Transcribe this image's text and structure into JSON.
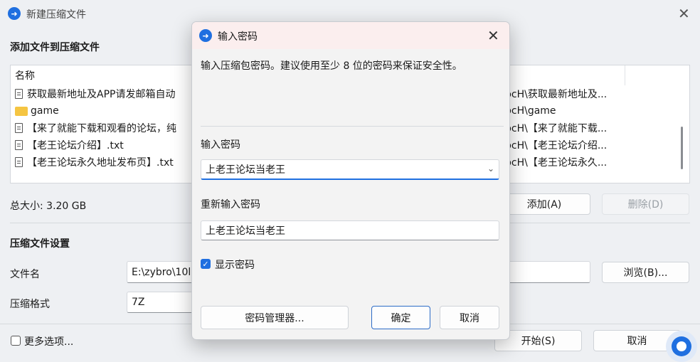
{
  "main": {
    "title": "新建压缩文件",
    "section_add": "添加文件到压缩文件",
    "column_name": "名称",
    "files": [
      {
        "name": "获取最新地址及APP请发邮箱自动",
        "path": "pcH\\获取最新地址及...",
        "icon": "file"
      },
      {
        "name": "game",
        "path": "pcH\\game",
        "icon": "folder"
      },
      {
        "name": "【来了就能下载和观看的论坛，纯",
        "path": "pcH\\【来了就能下载...",
        "icon": "file"
      },
      {
        "name": "【老王论坛介绍】.txt",
        "path": "pcH\\【老王论坛介绍...",
        "icon": "file"
      },
      {
        "name": "【老王论坛永久地址发布页】.txt",
        "path": "pcH\\【老王论坛永久...",
        "icon": "file"
      }
    ],
    "total_size": "总大小: 3.20 GB",
    "add_button": "添加(A)",
    "delete_button": "删除(D)",
    "section_settings": "压缩文件设置",
    "filename_label": "文件名",
    "filename_value": "E:\\zybro\\10l",
    "browse_button": "浏览(B)...",
    "format_label": "压缩格式",
    "format_value": "7Z",
    "more_options": "更多选项...",
    "start_button": "开始(S)",
    "cancel_button": "取消"
  },
  "dialog": {
    "title": "输入密码",
    "description": "输入压缩包密码。建议使用至少 8 位的密码来保证安全性。",
    "password_label": "输入密码",
    "password_value": "上老王论坛当老王",
    "reenter_label": "重新输入密码",
    "reenter_value": "上老王论坛当老王",
    "show_password_label": "显示密码",
    "show_password_checked": true,
    "manager_button": "密码管理器...",
    "ok_button": "确定",
    "cancel_button": "取消"
  },
  "colors": {
    "accent": "#1f6fe0",
    "dialog_header": "#fbeeee"
  }
}
